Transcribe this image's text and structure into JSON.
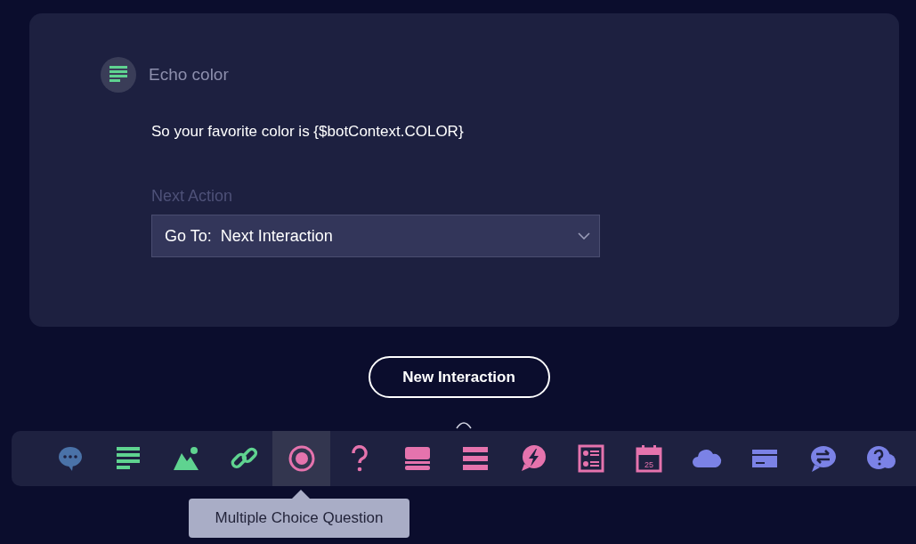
{
  "card": {
    "title": "Echo color",
    "message": "So your favorite color is {$botContext.COLOR}",
    "next_action": {
      "label": "Next Action",
      "value": "Go To:  Next Interaction"
    }
  },
  "new_button": "New Interaction",
  "toolbar": [
    {
      "kind": "chat",
      "color": "#4a72a8",
      "selected": false
    },
    {
      "kind": "text",
      "color": "#5fd390",
      "selected": false
    },
    {
      "kind": "image",
      "color": "#5fd390",
      "selected": false
    },
    {
      "kind": "link",
      "color": "#5fd390",
      "selected": false
    },
    {
      "kind": "radio",
      "color": "#e573ad",
      "selected": true
    },
    {
      "kind": "question",
      "color": "#e573ad",
      "selected": false
    },
    {
      "kind": "card",
      "color": "#e573ad",
      "selected": false
    },
    {
      "kind": "list",
      "color": "#e573ad",
      "selected": false
    },
    {
      "kind": "bolt",
      "color": "#e573ad",
      "selected": false
    },
    {
      "kind": "form",
      "color": "#e573ad",
      "selected": false
    },
    {
      "kind": "calendar",
      "color": "#e573ad",
      "selected": false,
      "label": "25"
    },
    {
      "kind": "cloud",
      "color": "#7b82e6",
      "selected": false
    },
    {
      "kind": "payment",
      "color": "#7b82e6",
      "selected": false
    },
    {
      "kind": "swap",
      "color": "#7b82e6",
      "selected": false
    },
    {
      "kind": "help",
      "color": "#7b82e6",
      "selected": false
    }
  ],
  "tooltip": "Multiple Choice Question"
}
